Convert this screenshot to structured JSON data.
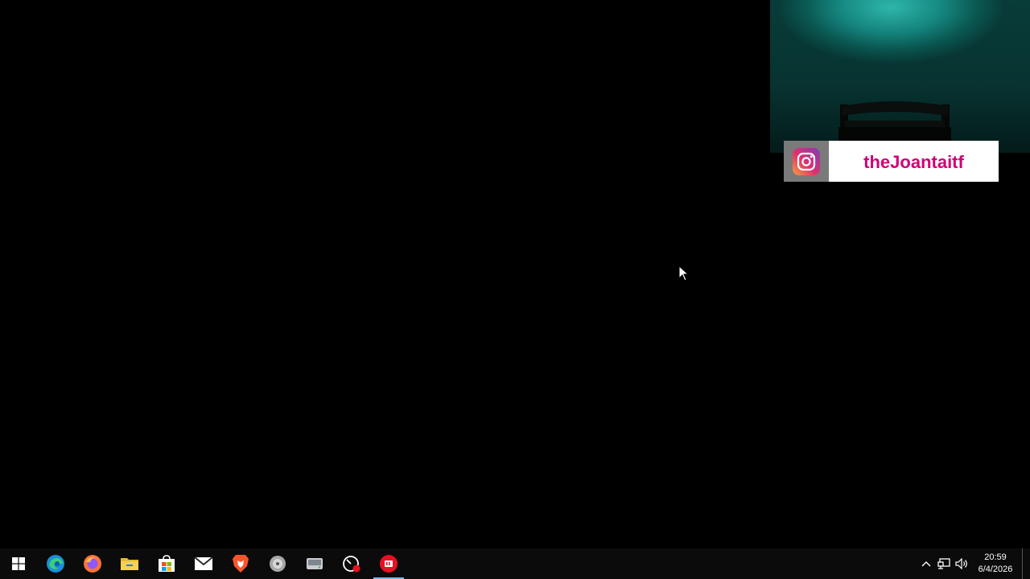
{
  "overlay": {
    "instagram_handle": "theJoantaitf"
  },
  "taskbar": {
    "apps": [
      {
        "name": "start",
        "icon": "windows-logo-icon"
      },
      {
        "name": "edge",
        "icon": "edge-icon"
      },
      {
        "name": "firefox",
        "icon": "firefox-icon"
      },
      {
        "name": "file-explorer",
        "icon": "folder-icon"
      },
      {
        "name": "store",
        "icon": "store-icon"
      },
      {
        "name": "mail",
        "icon": "mail-icon"
      },
      {
        "name": "brave",
        "icon": "brave-icon"
      },
      {
        "name": "disc-app",
        "icon": "disc-icon"
      },
      {
        "name": "drive-app",
        "icon": "drive-icon"
      },
      {
        "name": "speed-app",
        "icon": "gauge-icon"
      },
      {
        "name": "recorder-app",
        "icon": "recorder-icon",
        "active": true
      }
    ],
    "clock": {
      "time": "20:59",
      "date": "6/4/2026"
    }
  },
  "colors": {
    "desktop_bg": "#000000",
    "taskbar_bg": "#0b0b0b",
    "ig_handle": "#d10074",
    "active_indicator": "#76b9ed"
  }
}
